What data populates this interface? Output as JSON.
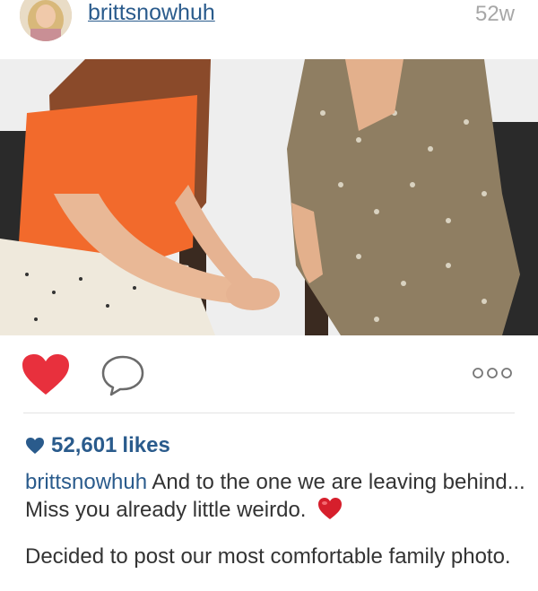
{
  "post": {
    "username": "brittsnowhuh",
    "time_ago": "52w"
  },
  "actions": {
    "like_icon": "heart-filled-icon",
    "comment_icon": "speech-bubble-icon",
    "more_icon": "ellipsis-icon"
  },
  "likes": {
    "count": "52,601",
    "label": "likes"
  },
  "caption": {
    "username": "brittsnowhuh",
    "text": "And to the one we are leaving behind... Miss you already little weirdo.",
    "emoji": "red-heart-emoji"
  },
  "comment_preview": {
    "text": "Decided to post our most comfortable family photo."
  },
  "colors": {
    "link_blue": "#2a5b8c",
    "heart_red": "#e8303d",
    "timestamp_gray": "#a7a7a7"
  }
}
